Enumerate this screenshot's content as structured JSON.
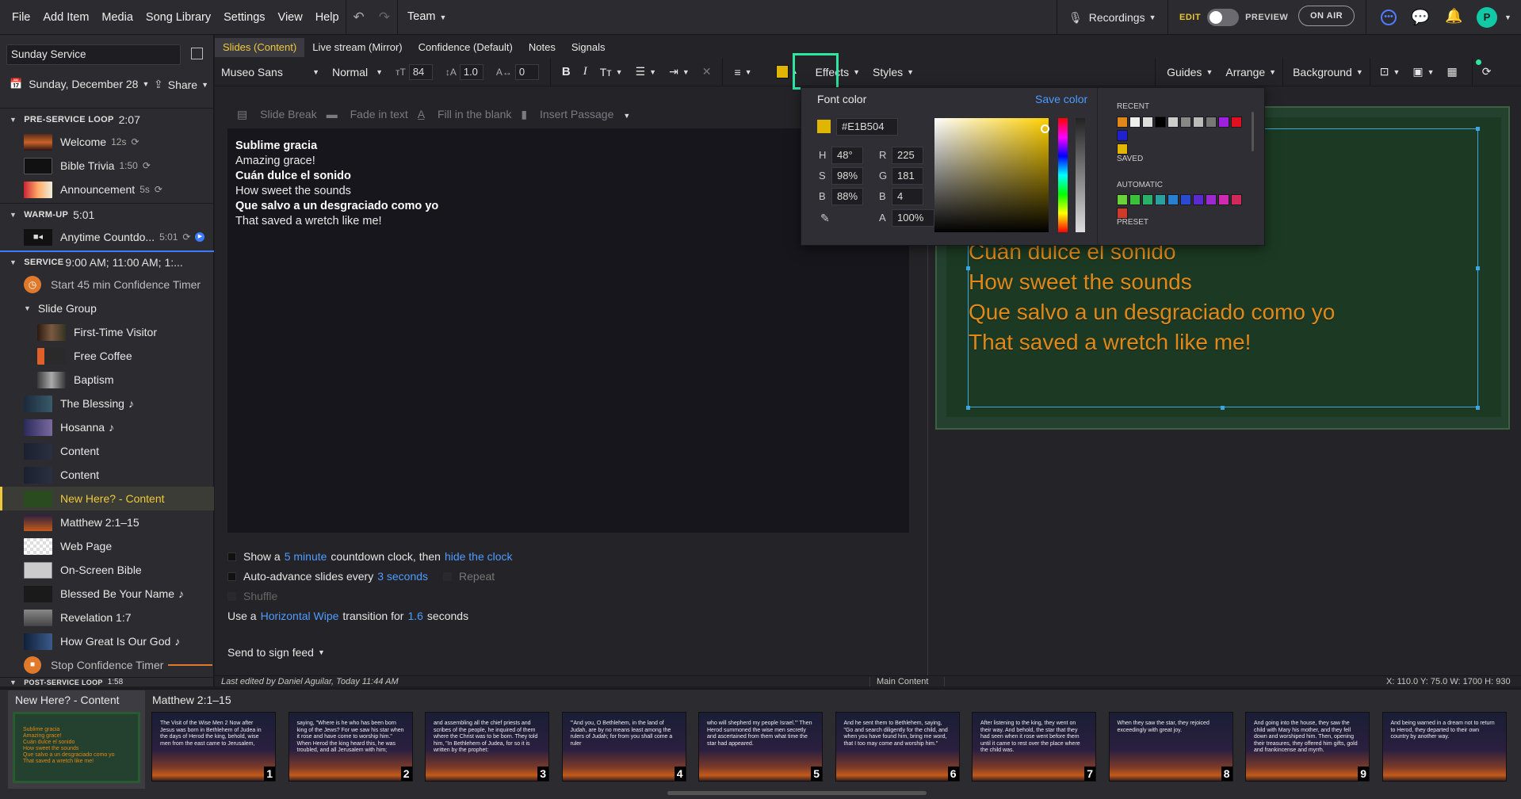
{
  "menu": [
    "File",
    "Add Item",
    "Media",
    "Song Library",
    "Settings",
    "View",
    "Help"
  ],
  "team_label": "Team",
  "recordings_label": "Recordings",
  "edit_label": "EDIT",
  "preview_label": "PREVIEW",
  "on_air_label": "ON AIR",
  "plan": {
    "title": "Sunday Service",
    "date": "Sunday, December 28",
    "share": "Share"
  },
  "sections": [
    {
      "label": "PRE-SERVICE LOOP",
      "length": "2:07"
    },
    {
      "label": "WARM-UP",
      "length": "5:01"
    },
    {
      "label": "SERVICE",
      "length": "9:00 AM; 11:00 AM; 1:..."
    },
    {
      "label": "POST-SERVICE LOOP",
      "length": "1:58"
    }
  ],
  "items": {
    "welcome": {
      "label": "Welcome",
      "dur": "12s"
    },
    "trivia": {
      "label": "Bible Trivia",
      "dur": "1:50"
    },
    "announce": {
      "label": "Announcement",
      "dur": "5s"
    },
    "countdown": {
      "label": "Anytime Countdo...",
      "dur": "5:01"
    },
    "start_timer": {
      "label": "Start 45 min Confidence Timer"
    },
    "slide_group": {
      "label": "Slide Group"
    },
    "first_time": {
      "label": "First-Time Visitor"
    },
    "coffee": {
      "label": "Free Coffee"
    },
    "baptism": {
      "label": "Baptism"
    },
    "blessing": {
      "label": "The Blessing"
    },
    "hosanna": {
      "label": "Hosanna"
    },
    "content1": {
      "label": "Content"
    },
    "content2": {
      "label": "Content"
    },
    "new_here": {
      "label": "New Here? - Content"
    },
    "matthew": {
      "label": "Matthew 2:1–15"
    },
    "web": {
      "label": "Web Page"
    },
    "bible": {
      "label": "On-Screen Bible"
    },
    "blessed": {
      "label": "Blessed Be Your Name"
    },
    "revelation": {
      "label": "Revelation 1:7"
    },
    "how_great": {
      "label": "How Great Is Our God"
    },
    "stop_timer": {
      "label": "Stop Confidence Timer"
    }
  },
  "tabs": [
    "Slides (Content)",
    "Live stream (Mirror)",
    "Confidence (Default)",
    "Notes",
    "Signals"
  ],
  "format": {
    "font": "Museo Sans",
    "weight": "Normal",
    "size": "84",
    "line": "1.0",
    "spacing": "0",
    "effects": "Effects",
    "styles": "Styles",
    "guides": "Guides",
    "arrange": "Arrange",
    "background": "Background"
  },
  "editor_tools": [
    "Slide Break",
    "Fade in text",
    "Fill in the blank",
    "Insert Passage"
  ],
  "lyrics": [
    "Sublime gracia",
    "Amazing grace!",
    "Cuán dulce el sonido",
    "How sweet the sounds",
    "Que salvo a un desgraciado como yo",
    "That saved a wretch like me!"
  ],
  "options": {
    "countdown": {
      "pre": "Show a",
      "link1": "5 minute",
      "mid": "countdown clock, then",
      "link2": "hide the clock"
    },
    "advance": {
      "pre": "Auto-advance slides every",
      "link1": "3 seconds",
      "repeat": "Repeat"
    },
    "shuffle": "Shuffle",
    "transition": {
      "pre": "Use a",
      "link1": "Horizontal Wipe",
      "mid": "transition for",
      "link2": "1.6",
      "post": "seconds"
    },
    "sign_feed": "Send to sign feed"
  },
  "status": {
    "edited": "Last edited by Daniel Aguilar, Today 11:44 AM",
    "layer": "Main Content",
    "coords": "X: 110.0  Y: 75.0     W: 1700  H: 930"
  },
  "preview_lines": [
    "Cuán dulce el sonido",
    "How sweet the sounds",
    "Que salvo a un desgraciado como yo",
    "That saved a wretch like me!"
  ],
  "color_popup": {
    "title": "Font color",
    "save": "Save color",
    "hex": "#E1B504",
    "h": "48°",
    "s": "98%",
    "b": "88%",
    "r": "225",
    "g": "181",
    "b2": "4",
    "a": "100%",
    "recent": "RECENT",
    "saved": "SAVED",
    "automatic": "AUTOMATIC",
    "preset": "PRESET"
  },
  "colors": {
    "accent": "#E1B504",
    "lyric_preview": "#e0891a",
    "highlight": "#2ee6a0",
    "link": "#4f9bff"
  },
  "strip": {
    "current_label": "New Here? - Content",
    "next_label": "Matthew 2:1–15",
    "slides": [
      {
        "n": "1",
        "text": "The Visit of the Wise Men 2 Now after Jesus was born in Bethlehem of Judea in the days of Herod the king, behold, wise men from the east came to Jerusalem,"
      },
      {
        "n": "2",
        "text": "saying, \"Where is he who has been born king of the Jews? For we saw his star when it rose and have come to worship him.\" When Herod the king heard this, he was troubled, and all Jerusalem with him;"
      },
      {
        "n": "3",
        "text": "and assembling all the chief priests and scribes of the people, he inquired of them where the Christ was to be born. They told him, \"In Bethlehem of Judea, for so it is written by the prophet:"
      },
      {
        "n": "4",
        "text": "\"'And you, O Bethlehem, in the land of Judah, are by no means least among the rulers of Judah; for from you shall come a ruler"
      },
      {
        "n": "5",
        "text": "who will shepherd my people Israel.'\" Then Herod summoned the wise men secretly and ascertained from them what time the star had appeared."
      },
      {
        "n": "6",
        "text": "And he sent them to Bethlehem, saying, \"Go and search diligently for the child, and when you have found him, bring me word, that I too may come and worship him.\""
      },
      {
        "n": "7",
        "text": "After listening to the king, they went on their way. And behold, the star that they had seen when it rose went before them until it came to rest over the place where the child was."
      },
      {
        "n": "8",
        "text": "When they saw the star, they rejoiced exceedingly with great joy."
      },
      {
        "n": "9",
        "text": "And going into the house, they saw the child with Mary his mother, and they fell down and worshiped him. Then, opening their treasures, they offered him gifts, gold and frankincense and myrrh."
      },
      {
        "n": "",
        "text": "And being warned in a dream not to return to Herod, they departed to their own country by another way."
      }
    ]
  }
}
